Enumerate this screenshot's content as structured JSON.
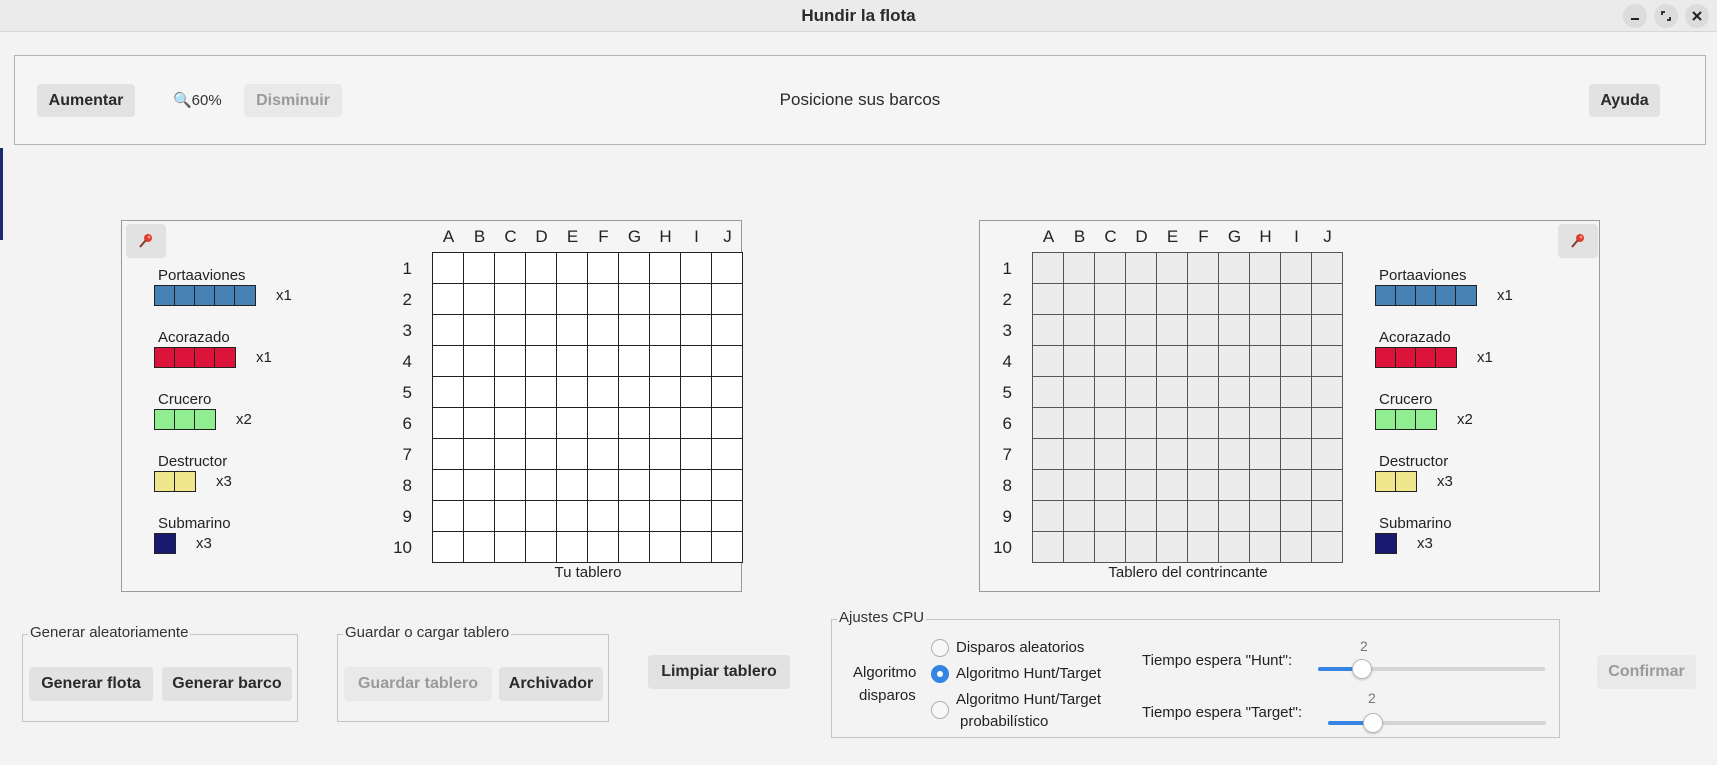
{
  "window": {
    "title": "Hundir la flota",
    "minimize_icon": "minimize-icon",
    "maximize_icon": "maximize-icon",
    "close_icon": "close-icon"
  },
  "toolbar": {
    "increase_label": "Aumentar",
    "zoom_text": "🔍60%",
    "decrease_label": "Disminuir",
    "status_text": "Posicione sus barcos",
    "help_label": "Ayuda"
  },
  "own_board": {
    "caption": "Tu tablero",
    "pin_icon": "pin-icon"
  },
  "enemy_board": {
    "caption": "Tablero del contrincante",
    "pin_icon": "pin-icon"
  },
  "columns": [
    "A",
    "B",
    "C",
    "D",
    "E",
    "F",
    "G",
    "H",
    "I",
    "J"
  ],
  "rows": [
    "1",
    "2",
    "3",
    "4",
    "5",
    "6",
    "7",
    "8",
    "9",
    "10"
  ],
  "ships": [
    {
      "name": "Portaaviones",
      "count": "x1",
      "size": 5,
      "color": "#4682b4"
    },
    {
      "name": "Acorazado",
      "count": "x1",
      "size": 4,
      "color": "#dc143c"
    },
    {
      "name": "Crucero",
      "count": "x2",
      "size": 3,
      "color": "#90ee90"
    },
    {
      "name": "Destructor",
      "count": "x3",
      "size": 2,
      "color": "#f0e68c"
    },
    {
      "name": "Submarino",
      "count": "x3",
      "size": 1,
      "color": "#191970"
    }
  ],
  "random_group": {
    "title": "Generar aleatoriamente",
    "fleet_label": "Generar flota",
    "ship_label": "Generar barco"
  },
  "save_group": {
    "title": "Guardar o cargar tablero",
    "save_label": "Guardar tablero",
    "archive_label": "Archivador"
  },
  "clear_label": "Limpiar tablero",
  "cpu": {
    "title": "Ajustes CPU",
    "algorithm_label_1": "Algoritmo",
    "algorithm_label_2": "disparos",
    "options": [
      {
        "label": "Disparos aleatorios",
        "checked": false
      },
      {
        "label": "Algoritmo Hunt/Target",
        "checked": true
      },
      {
        "label": "Algoritmo Hunt/Target",
        "label2": "probabilístico",
        "checked": false
      }
    ],
    "hunt_label": "Tiempo espera \"Hunt\":",
    "hunt_value": "2",
    "target_label": "Tiempo espera \"Target\":",
    "target_value": "2"
  },
  "confirm_label": "Confirmar"
}
